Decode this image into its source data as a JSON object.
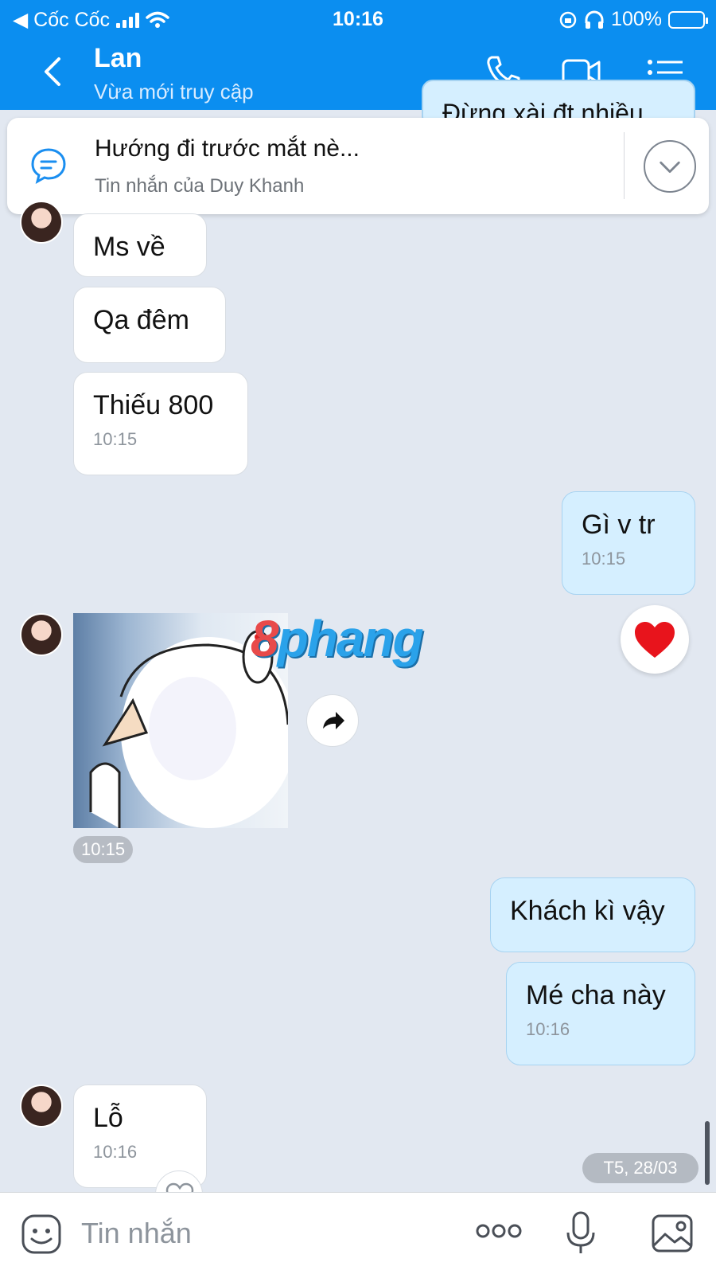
{
  "status_bar": {
    "back_app": "◀ Cốc Cốc",
    "time": "10:16",
    "battery": "100%"
  },
  "header": {
    "name": "Lan",
    "subtitle": "Vừa mới truy cập"
  },
  "pinned": {
    "title": "Hướng đi trước mắt nè...",
    "subtitle": "Tin nhắn của Duy Khanh"
  },
  "peek_message": "Đừng xài đt nhiều",
  "messages": [
    {
      "dir": "in",
      "text": "Ms về",
      "time": ""
    },
    {
      "dir": "in",
      "text": "Qa đêm",
      "time": ""
    },
    {
      "dir": "in",
      "text": "Thiếu 800",
      "time": "10:15"
    },
    {
      "dir": "out",
      "text": "Gì v tr",
      "time": "10:15"
    },
    {
      "dir": "out",
      "text": "Khách kì vậy",
      "time": ""
    },
    {
      "dir": "out",
      "text": "Mé cha này",
      "time": "10:16"
    },
    {
      "dir": "in",
      "text": "Lỗ",
      "time": "10:16"
    }
  ],
  "sticker": {
    "time": "10:15",
    "watermark_a": "8",
    "watermark_b": "phang"
  },
  "date_pill": "T5, 28/03",
  "composer": {
    "placeholder": "Tin nhắn"
  },
  "colors": {
    "header": "#0b8ef0",
    "outgoing": "#d5efff",
    "incoming": "#ffffff",
    "background": "#e2e8f1"
  }
}
